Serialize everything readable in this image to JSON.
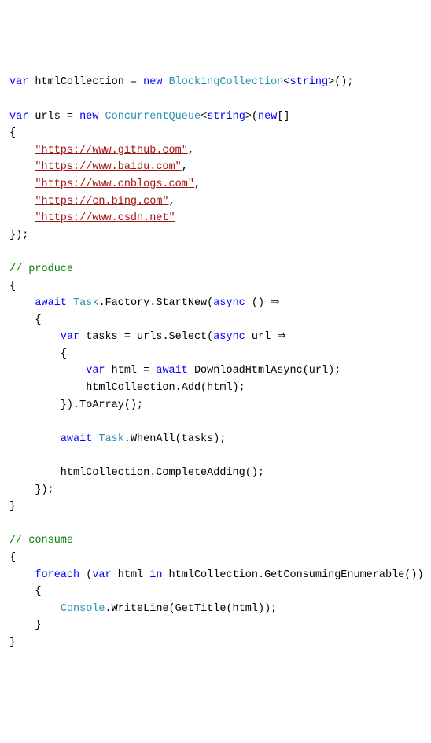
{
  "line1": {
    "var1": "var",
    "ident1": " htmlCollection = ",
    "new1": "new",
    "sp1": " ",
    "type1": "BlockingCollection",
    "lt1": "<",
    "string1": "string",
    "gt1": ">();"
  },
  "line3": {
    "var2": "var",
    "ident2": " urls = ",
    "new2": "new",
    "sp2": " ",
    "type2": "ConcurrentQueue",
    "lt2": "<",
    "string2": "string",
    "gt2": ">(",
    "new3": "new",
    "bracket": "[]"
  },
  "brace_open1": "{",
  "url_indent": "    ",
  "url1": "\"https://www.github.com\"",
  "url2": "\"https://www.baidu.com\"",
  "url3": "\"https://www.cnblogs.com\"",
  "url4": "\"https://cn.bing.com\"",
  "url5": "\"https://www.csdn.net\"",
  "comma": ",",
  "close_arr": "});",
  "comment_produce": "// produce",
  "brace_open2": "{",
  "produce_line1": {
    "indent": "    ",
    "await": "await",
    "sp": " ",
    "task": "Task",
    "mid": ".Factory.StartNew(",
    "async": "async",
    "rest": " () ⇒"
  },
  "produce_brace_open": "    {",
  "produce_line2": {
    "indent": "        ",
    "var": "var",
    "mid": " tasks = urls.Select(",
    "async": "async",
    "rest": " url ⇒"
  },
  "produce_inner_open": "        {",
  "produce_line3": {
    "indent": "            ",
    "var": "var",
    "mid": " html = ",
    "await": "await",
    "rest": " DownloadHtmlAsync(url);"
  },
  "produce_line4": "            htmlCollection.Add(html);",
  "produce_inner_close": "        }).ToArray();",
  "produce_line5": {
    "indent": "        ",
    "await": "await",
    "sp": " ",
    "task": "Task",
    "rest": ".WhenAll(tasks);"
  },
  "produce_line6": "        htmlCollection.CompleteAdding();",
  "produce_brace_close": "    });",
  "brace_close2": "}",
  "comment_consume": "// consume",
  "brace_open3": "{",
  "consume_line1": {
    "indent": "    ",
    "foreach": "foreach",
    "open": " (",
    "var": "var",
    "mid": " html ",
    "in": "in",
    "rest": " htmlCollection.GetConsumingEnumerable())"
  },
  "consume_brace_open": "    {",
  "consume_line2": {
    "indent": "        ",
    "type": "Console",
    "rest": ".WriteLine(GetTitle(html));"
  },
  "consume_brace_close": "    }",
  "brace_close3": "}"
}
